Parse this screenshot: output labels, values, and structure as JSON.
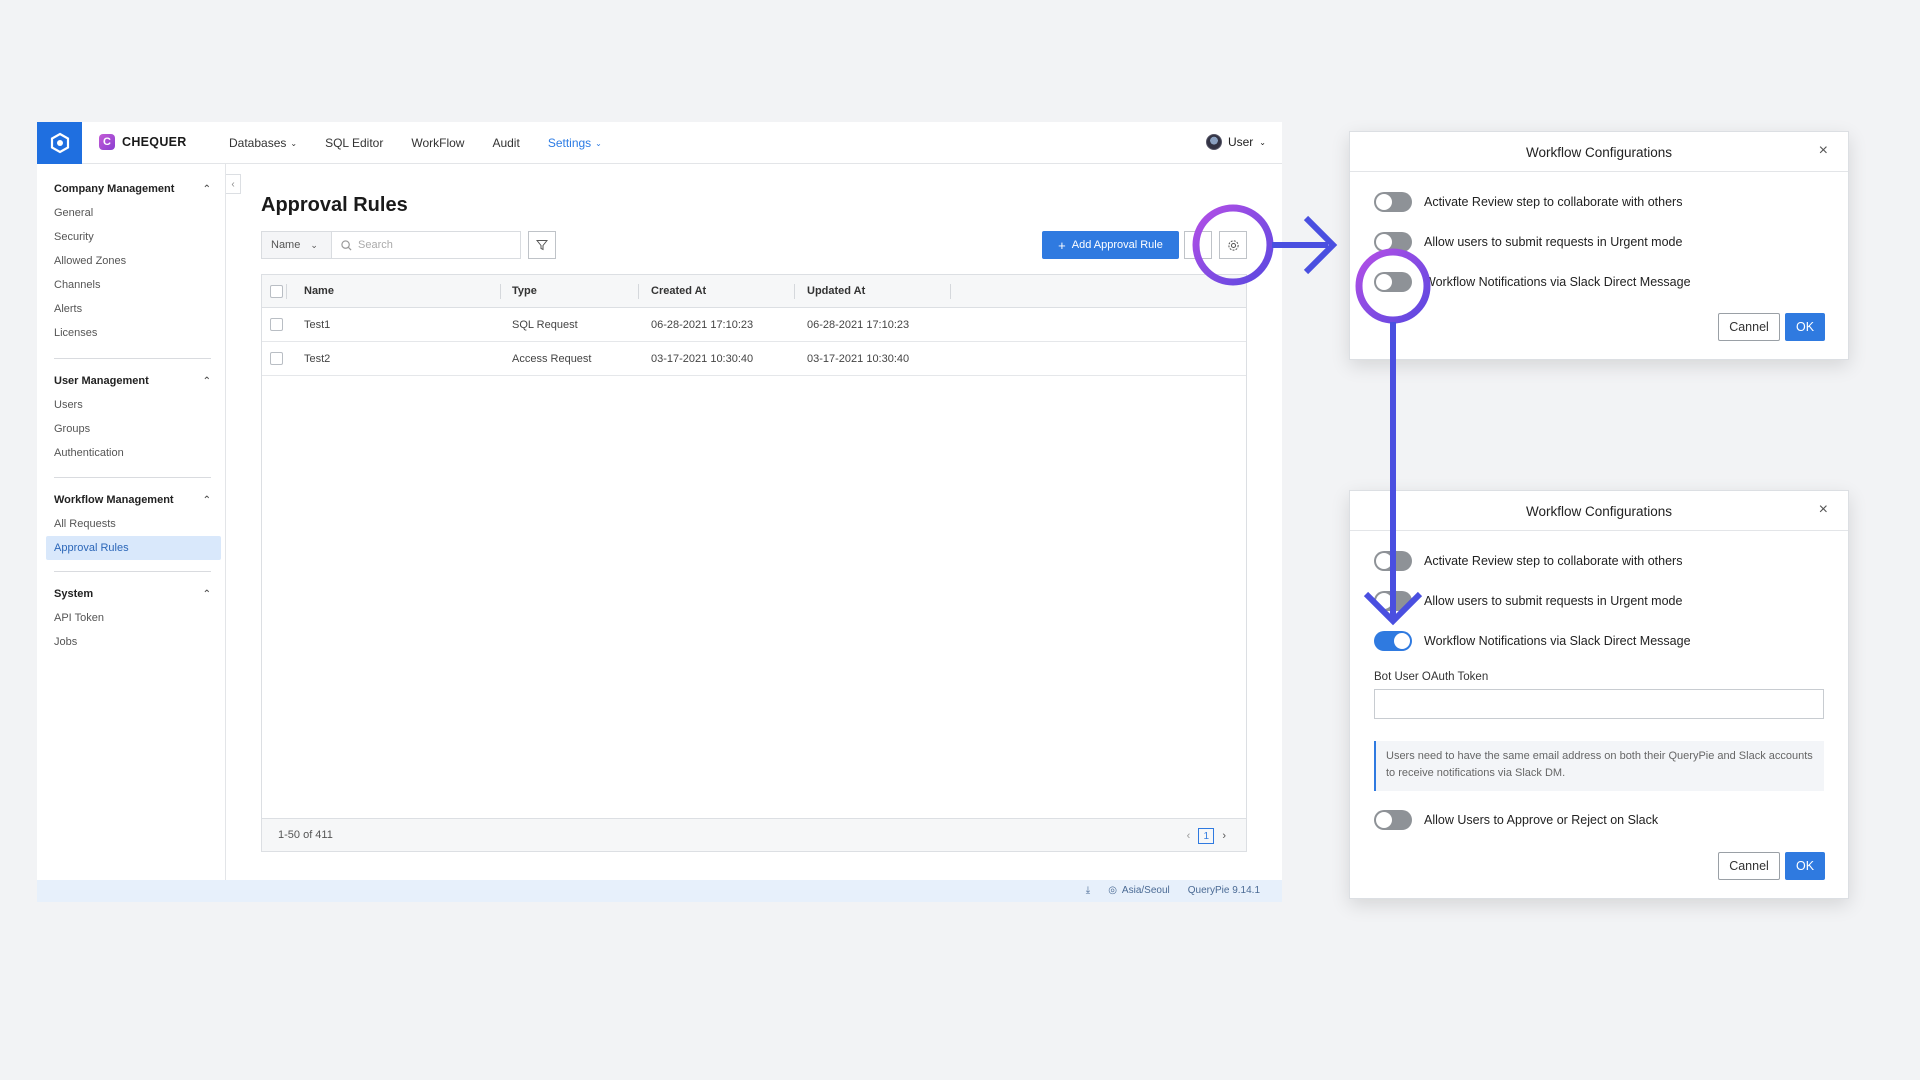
{
  "topbar": {
    "brand": "CHEQUER",
    "brand_letter": "C",
    "nav": [
      {
        "label": "Databases",
        "dropdown": true
      },
      {
        "label": "SQL Editor"
      },
      {
        "label": "WorkFlow"
      },
      {
        "label": "Audit"
      },
      {
        "label": "Settings",
        "dropdown": true,
        "active": true
      }
    ],
    "user_label": "User"
  },
  "sidebar": {
    "groups": [
      {
        "title": "Company Management",
        "items": [
          "General",
          "Security",
          "Allowed Zones",
          "Channels",
          "Alerts",
          "Licenses"
        ]
      },
      {
        "title": "User Management",
        "items": [
          "Users",
          "Groups",
          "Authentication"
        ]
      },
      {
        "title": "Workflow Management",
        "items": [
          "All Requests",
          "Approval Rules"
        ],
        "active_item": "Approval Rules"
      },
      {
        "title": "System",
        "items": [
          "API Token",
          "Jobs"
        ]
      }
    ]
  },
  "main": {
    "title": "Approval Rules",
    "filter_field": "Name",
    "search_placeholder": "Search",
    "add_button": "Add Approval Rule",
    "table": {
      "columns": [
        "Name",
        "Type",
        "Created At",
        "Updated At"
      ],
      "rows": [
        [
          "Test1",
          "SQL Request",
          "06-28-2021 17:10:23",
          "06-28-2021 17:10:23"
        ],
        [
          "Test2",
          "Access Request",
          "03-17-2021 10:30:40",
          "03-17-2021 10:30:40"
        ]
      ],
      "range_text": "1-50 of 411",
      "page": "1"
    }
  },
  "statusbar": {
    "timezone": "Asia/Seoul",
    "version": "QueryPie 9.14.1"
  },
  "dialog1": {
    "title": "Workflow Configurations",
    "options": [
      {
        "label": "Activate Review step to collaborate with others",
        "on": false
      },
      {
        "label": "Allow users to submit requests in Urgent mode",
        "on": false
      },
      {
        "label": "Workflow Notifications via Slack Direct Message",
        "on": false
      }
    ],
    "cancel": "Cannel",
    "ok": "OK"
  },
  "dialog2": {
    "title": "Workflow Configurations",
    "options": [
      {
        "label": "Activate Review step to collaborate with others",
        "on": false
      },
      {
        "label": "Allow users to submit requests in Urgent mode",
        "on": false
      },
      {
        "label": "Workflow Notifications via Slack Direct Message",
        "on": true
      }
    ],
    "token_label": "Bot User OAuth Token",
    "token_value": "",
    "hint": "Users need to have the same email address on both their QueryPie and Slack accounts to receive notifications via Slack DM.",
    "approve_option": {
      "label": "Allow Users to Approve or Reject on Slack",
      "on": false
    },
    "cancel": "Cannel",
    "ok": "OK"
  },
  "colors": {
    "accent": "#2f7ae0",
    "annotation_ring": "#a44ee8",
    "annotation_arrow": "#4a4fe0"
  }
}
